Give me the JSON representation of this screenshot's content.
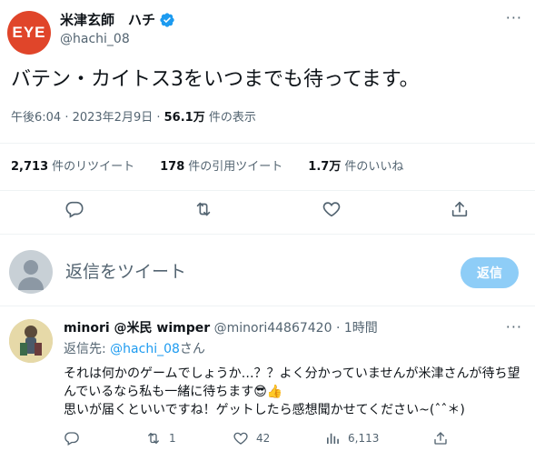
{
  "author": {
    "avatar_text": "EYE",
    "name": "米津玄師　ハチ",
    "handle": "@hachi_08"
  },
  "more_label": "···",
  "tweet": {
    "text": "バテン・カイトス3をいつまでも待ってます。",
    "time_date": "午後6:04 · 2023年2月9日 · ",
    "views": "56.1万",
    "views_suffix": " 件の表示"
  },
  "stats": {
    "retweets": "2,713",
    "retweets_label": "件のリツイート",
    "quotes": "178",
    "quotes_label": "件の引用ツイート",
    "likes": "1.7万",
    "likes_label": "件のいいね"
  },
  "compose": {
    "placeholder": "返信をツイート",
    "button": "返信"
  },
  "reply": {
    "name": "minori @米民 wimper",
    "handle_time": " @minori44867420 · 1時間",
    "reply_to_prefix": "返信先: ",
    "reply_to_handle": "@hachi_08",
    "reply_to_suffix": "さん",
    "body_line1": "それは何かのゲームでしょうか…？？よく分かっていませんが米津さんが待ち望んでいるなら私も一緒に待ちます😎👍",
    "body_line2": "思いが届くといいですね！ゲットしたら感想聞かせてください~(ˆˆ＊)",
    "retweets": "1",
    "likes": "42",
    "views": "6,113"
  },
  "colors": {
    "accent": "#1d9bf0",
    "avatar_bg": "#e0452a",
    "reply_button_bg": "#8ecdf7",
    "secondary_text": "#536471"
  },
  "icons": [
    "verified-badge-icon",
    "more-icon",
    "reply-icon",
    "retweet-icon",
    "like-icon",
    "share-icon",
    "views-icon"
  ]
}
